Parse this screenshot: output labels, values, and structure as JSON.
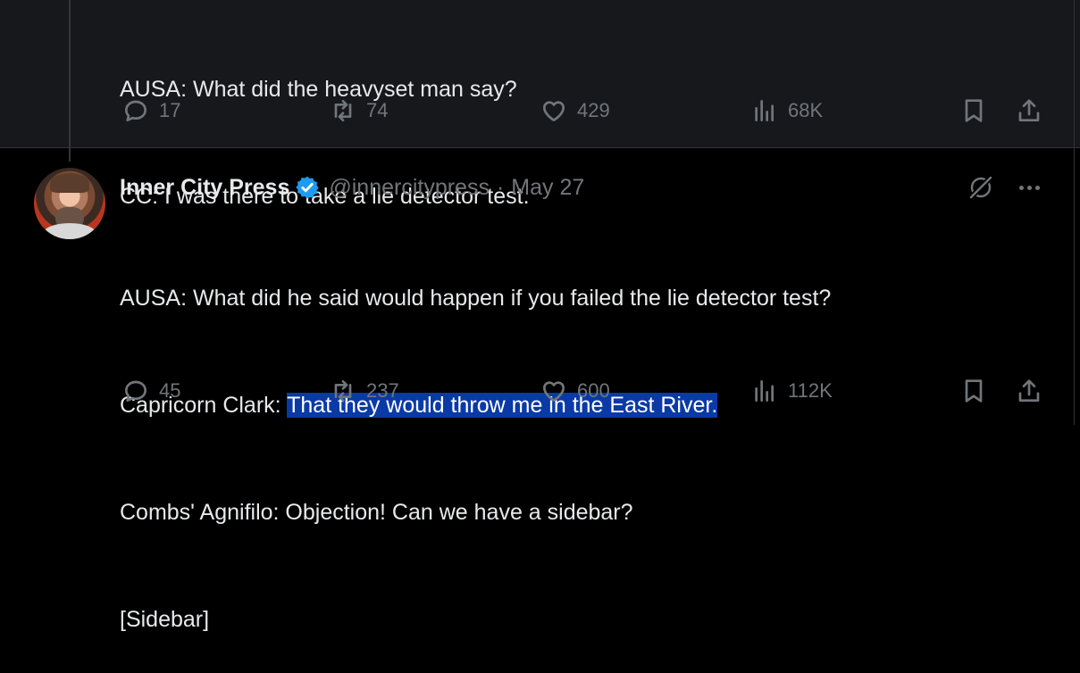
{
  "top_tweet": {
    "lines": [
      "AUSA: What did the heavyset man say?",
      "CC: I was there to take a lie detector test."
    ],
    "actions": {
      "replies": "17",
      "reposts": "74",
      "likes": "429",
      "views": "68K"
    }
  },
  "bottom_tweet": {
    "author_name": "Inner City Press",
    "handle": "@innercitypress",
    "separator": "·",
    "date": "May 27",
    "lines": {
      "l1": "AUSA: What did he said would happen if you failed the lie detector test?",
      "l2_prefix": "Capricorn Clark: ",
      "l2_highlight": "That they would throw me in the East River.",
      "l3": "Combs' Agnifilo: Objection! Can we have a sidebar?",
      "l4": "[Sidebar]"
    },
    "actions": {
      "replies": "45",
      "reposts": "237",
      "likes": "600",
      "views": "112K"
    }
  },
  "colors": {
    "background": "#000000",
    "thread_background": "#16181c",
    "text": "#e7e9ea",
    "muted": "#71767b",
    "verified": "#1d9bf0",
    "selection": "#0a3aa6"
  },
  "icons": [
    "reply-icon",
    "repost-icon",
    "like-icon",
    "views-icon",
    "bookmark-icon",
    "share-icon",
    "verified-badge-icon",
    "grok-icon",
    "more-icon"
  ]
}
